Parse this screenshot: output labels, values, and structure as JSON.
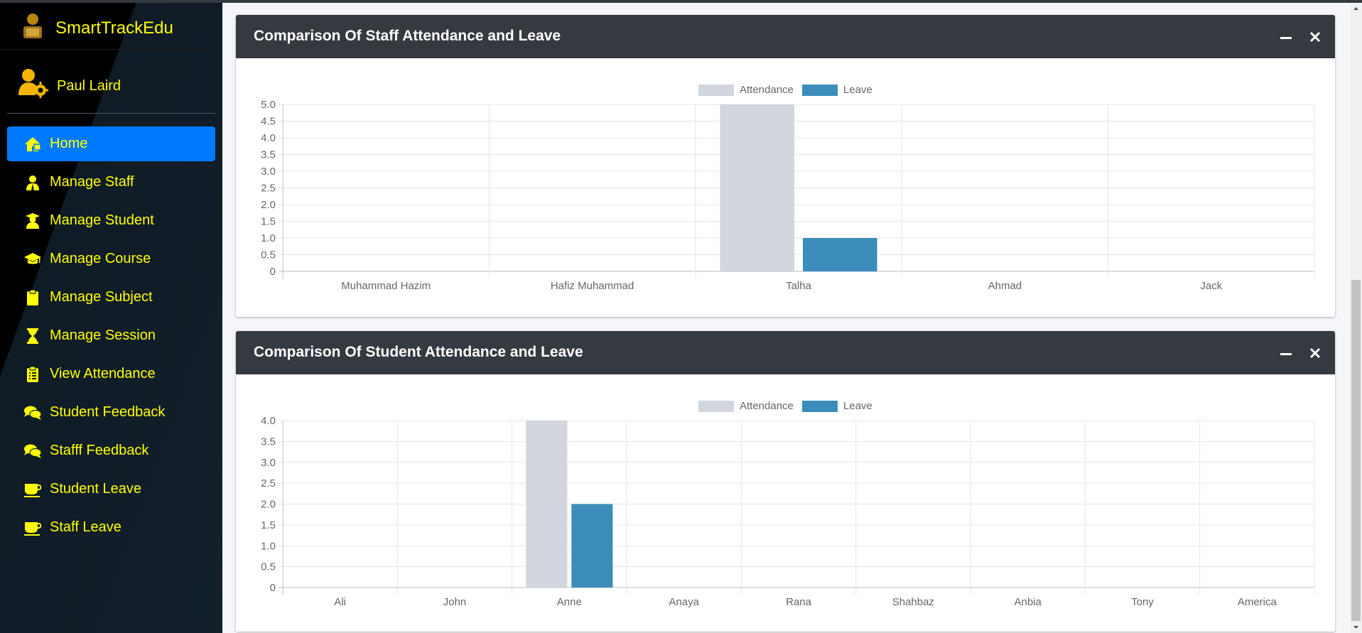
{
  "app": {
    "brand": "SmartTrackEdu",
    "user": "Paul Laird"
  },
  "nav": [
    {
      "label": "Home",
      "icon": "home-icon",
      "active": true
    },
    {
      "label": "Manage Staff",
      "icon": "staff-icon"
    },
    {
      "label": "Manage Student",
      "icon": "student-icon"
    },
    {
      "label": "Manage Course",
      "icon": "graduation-cap-icon"
    },
    {
      "label": "Manage Subject",
      "icon": "clipboard-icon"
    },
    {
      "label": "Manage Session",
      "icon": "hourglass-icon"
    },
    {
      "label": "View Attendance",
      "icon": "clipboard-list-icon"
    },
    {
      "label": "Student Feedback",
      "icon": "comments-icon"
    },
    {
      "label": "Stafff Feedback",
      "icon": "comments-icon"
    },
    {
      "label": "Student Leave",
      "icon": "coffee-icon"
    },
    {
      "label": "Staff Leave",
      "icon": "coffee-icon"
    }
  ],
  "colors": {
    "accent": "#ffff00",
    "active_bg": "#007bff",
    "attendance": "#d2d6de",
    "leave": "#3c8dbc"
  },
  "cards": [
    {
      "title": "Comparison Of Staff Attendance and Leave"
    },
    {
      "title": "Comparison Of Student Attendance and Leave"
    }
  ],
  "chart_data": [
    {
      "type": "bar",
      "title": "Comparison Of Staff Attendance and Leave",
      "categories": [
        "Muhammad Hazim",
        "Hafiz Muhammad",
        "Talha",
        "Ahmad",
        "Jack"
      ],
      "series": [
        {
          "name": "Attendance",
          "values": [
            0,
            0,
            5,
            0,
            0
          ]
        },
        {
          "name": "Leave",
          "values": [
            0,
            0,
            1,
            0,
            0
          ]
        }
      ],
      "ylim": [
        0,
        5
      ],
      "yticks": [
        "5.0",
        "4.5",
        "4.0",
        "3.5",
        "3.0",
        "2.5",
        "2.0",
        "1.5",
        "1.0",
        "0.5",
        "0"
      ],
      "grid": true,
      "legend": "top-center"
    },
    {
      "type": "bar",
      "title": "Comparison Of Student Attendance and Leave",
      "categories": [
        "Ali",
        "John",
        "Anne",
        "Anaya",
        "Rana",
        "Shahbaz",
        "Anbia",
        "Tony",
        "America"
      ],
      "series": [
        {
          "name": "Attendance",
          "values": [
            0,
            0,
            4,
            0,
            0,
            0,
            0,
            0,
            0
          ]
        },
        {
          "name": "Leave",
          "values": [
            0,
            0,
            2,
            0,
            0,
            0,
            0,
            0,
            0
          ]
        }
      ],
      "ylim": [
        0,
        4
      ],
      "yticks": [
        "4.0",
        "3.5",
        "3.0",
        "2.5",
        "2.0",
        "1.5",
        "1.0",
        "0.5",
        "0"
      ],
      "grid": true,
      "legend": "top-center"
    }
  ]
}
